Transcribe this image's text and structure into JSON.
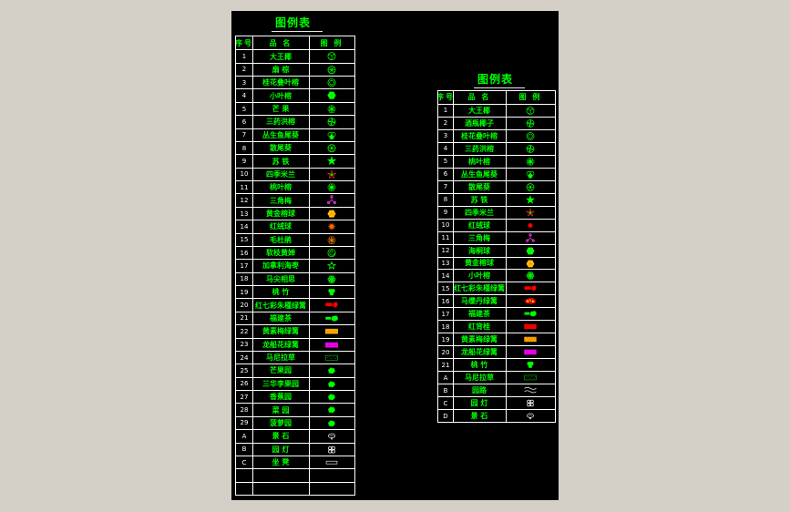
{
  "left_table": {
    "title": "图例表",
    "header": {
      "num": "序号",
      "name": "品  名",
      "legend": "图  例"
    },
    "rows": [
      {
        "num": "1",
        "name": "大王椰",
        "icon": "palm-circle-icon"
      },
      {
        "num": "2",
        "name": "扇  棕",
        "icon": "fan-palm-icon"
      },
      {
        "num": "3",
        "name": "桂花叠叶榕",
        "icon": "ring-circle-icon"
      },
      {
        "num": "4",
        "name": "小叶榕",
        "icon": "bush-blob-icon"
      },
      {
        "num": "5",
        "name": "芒  果",
        "icon": "star-blob-icon"
      },
      {
        "num": "6",
        "name": "三药洪榕",
        "icon": "pinwheel-icon"
      },
      {
        "num": "7",
        "name": "丛生鱼尾葵",
        "icon": "tree-cluster-icon"
      },
      {
        "num": "8",
        "name": "散尾葵",
        "icon": "spoke-circle-icon"
      },
      {
        "num": "9",
        "name": "苏  铁",
        "icon": "star-icon"
      },
      {
        "num": "10",
        "name": "四季米兰",
        "icon": "red-star-flower-icon"
      },
      {
        "num": "11",
        "name": "桃叶榕",
        "icon": "cluster-blob-icon"
      },
      {
        "num": "12",
        "name": "三角梅",
        "icon": "magenta-flower-icon"
      },
      {
        "num": "13",
        "name": "黄金榕球",
        "icon": "yellow-ball-icon"
      },
      {
        "num": "14",
        "name": "红绒球",
        "icon": "orange-sun-icon"
      },
      {
        "num": "15",
        "name": "毛杜鹃",
        "icon": "orange-ring-flower-icon"
      },
      {
        "num": "16",
        "name": "软枝黄婵",
        "icon": "spiral-circle-icon"
      },
      {
        "num": "17",
        "name": "加拿利海枣",
        "icon": "gear-circle-icon"
      },
      {
        "num": "18",
        "name": "马尖相思",
        "icon": "shrub-icon"
      },
      {
        "num": "19",
        "name": "桃  竹",
        "icon": "bamboo-icon"
      },
      {
        "num": "20",
        "name": "红七彩朱槿绿篱",
        "icon": "red-hedge-icon"
      },
      {
        "num": "21",
        "name": "福建茶",
        "icon": "green-hedge-icon"
      },
      {
        "num": "22",
        "name": "黄素梅绿篱",
        "icon": "yellow-hedge-icon"
      },
      {
        "num": "23",
        "name": "龙船花绿篱",
        "icon": "magenta-hedge-icon"
      },
      {
        "num": "24",
        "name": "马尼拉草",
        "icon": "grass-hatch-icon"
      },
      {
        "num": "25",
        "name": "芒果园",
        "icon": "cluster-icon"
      },
      {
        "num": "26",
        "name": "三华李果园",
        "icon": "cluster-icon"
      },
      {
        "num": "27",
        "name": "香蕉园",
        "icon": "cluster-icon"
      },
      {
        "num": "28",
        "name": "菜  园",
        "icon": "cluster-icon"
      },
      {
        "num": "29",
        "name": "菠萝园",
        "icon": "cluster-icon"
      },
      {
        "num": "A",
        "name": "景  石",
        "icon": "rock-icon"
      },
      {
        "num": "B",
        "name": "园  灯",
        "icon": "lamp-icon"
      },
      {
        "num": "C",
        "name": "坐  凳",
        "icon": "bench-icon"
      },
      {
        "num": "",
        "name": "",
        "icon": ""
      },
      {
        "num": "",
        "name": "",
        "icon": ""
      }
    ]
  },
  "right_table": {
    "title": "图例表",
    "header": {
      "num": "序号",
      "name": "品  名",
      "legend": "图  例"
    },
    "rows": [
      {
        "num": "1",
        "name": "大王椰",
        "icon": "palm-circle-icon"
      },
      {
        "num": "2",
        "name": "酒瓶椰子",
        "icon": "pinwheel-icon"
      },
      {
        "num": "3",
        "name": "桂花叠叶榕",
        "icon": "ring-circle-icon"
      },
      {
        "num": "4",
        "name": "三药洪榕",
        "icon": "pinwheel-icon"
      },
      {
        "num": "5",
        "name": "桃叶榕",
        "icon": "cluster-blob-icon"
      },
      {
        "num": "6",
        "name": "丛生鱼尾葵",
        "icon": "tree-cluster-icon"
      },
      {
        "num": "7",
        "name": "散尾葵",
        "icon": "spoke-circle-icon"
      },
      {
        "num": "8",
        "name": "苏  铁",
        "icon": "star-icon"
      },
      {
        "num": "9",
        "name": "四季米兰",
        "icon": "red-star-flower-icon"
      },
      {
        "num": "10",
        "name": "红绒球",
        "icon": "red-dot-icon"
      },
      {
        "num": "11",
        "name": "三角梅",
        "icon": "magenta-flower-icon"
      },
      {
        "num": "12",
        "name": "海桐球",
        "icon": "bush-blob-icon"
      },
      {
        "num": "13",
        "name": "黄金榕球",
        "icon": "yellow-ball-icon"
      },
      {
        "num": "14",
        "name": "小叶榕",
        "icon": "shrub-icon"
      },
      {
        "num": "15",
        "name": "红七彩朱槿绿篱",
        "icon": "red-hedge-icon"
      },
      {
        "num": "16",
        "name": "马缨丹绿篱",
        "icon": "mixed-hedge-icon"
      },
      {
        "num": "17",
        "name": "福建茶",
        "icon": "green-hedge-icon"
      },
      {
        "num": "18",
        "name": "红背桂",
        "icon": "red-hatch-icon"
      },
      {
        "num": "19",
        "name": "黄素梅绿篱",
        "icon": "yellow-hatch-icon"
      },
      {
        "num": "20",
        "name": "龙船花绿篱",
        "icon": "magenta-hedge-icon"
      },
      {
        "num": "21",
        "name": "桃  竹",
        "icon": "bamboo-icon"
      },
      {
        "num": "A",
        "name": "马尼拉草",
        "icon": "grass-hatch-icon"
      },
      {
        "num": "B",
        "name": "园路",
        "icon": "path-wave-icon"
      },
      {
        "num": "C",
        "name": "园  灯",
        "icon": "lamp-icon"
      },
      {
        "num": "D",
        "name": "景  石",
        "icon": "rock-icon"
      }
    ]
  },
  "colors": {
    "background": "#000000",
    "text": "#00ff00",
    "lines": "#ffffff",
    "frame": "#d4d0c8"
  }
}
